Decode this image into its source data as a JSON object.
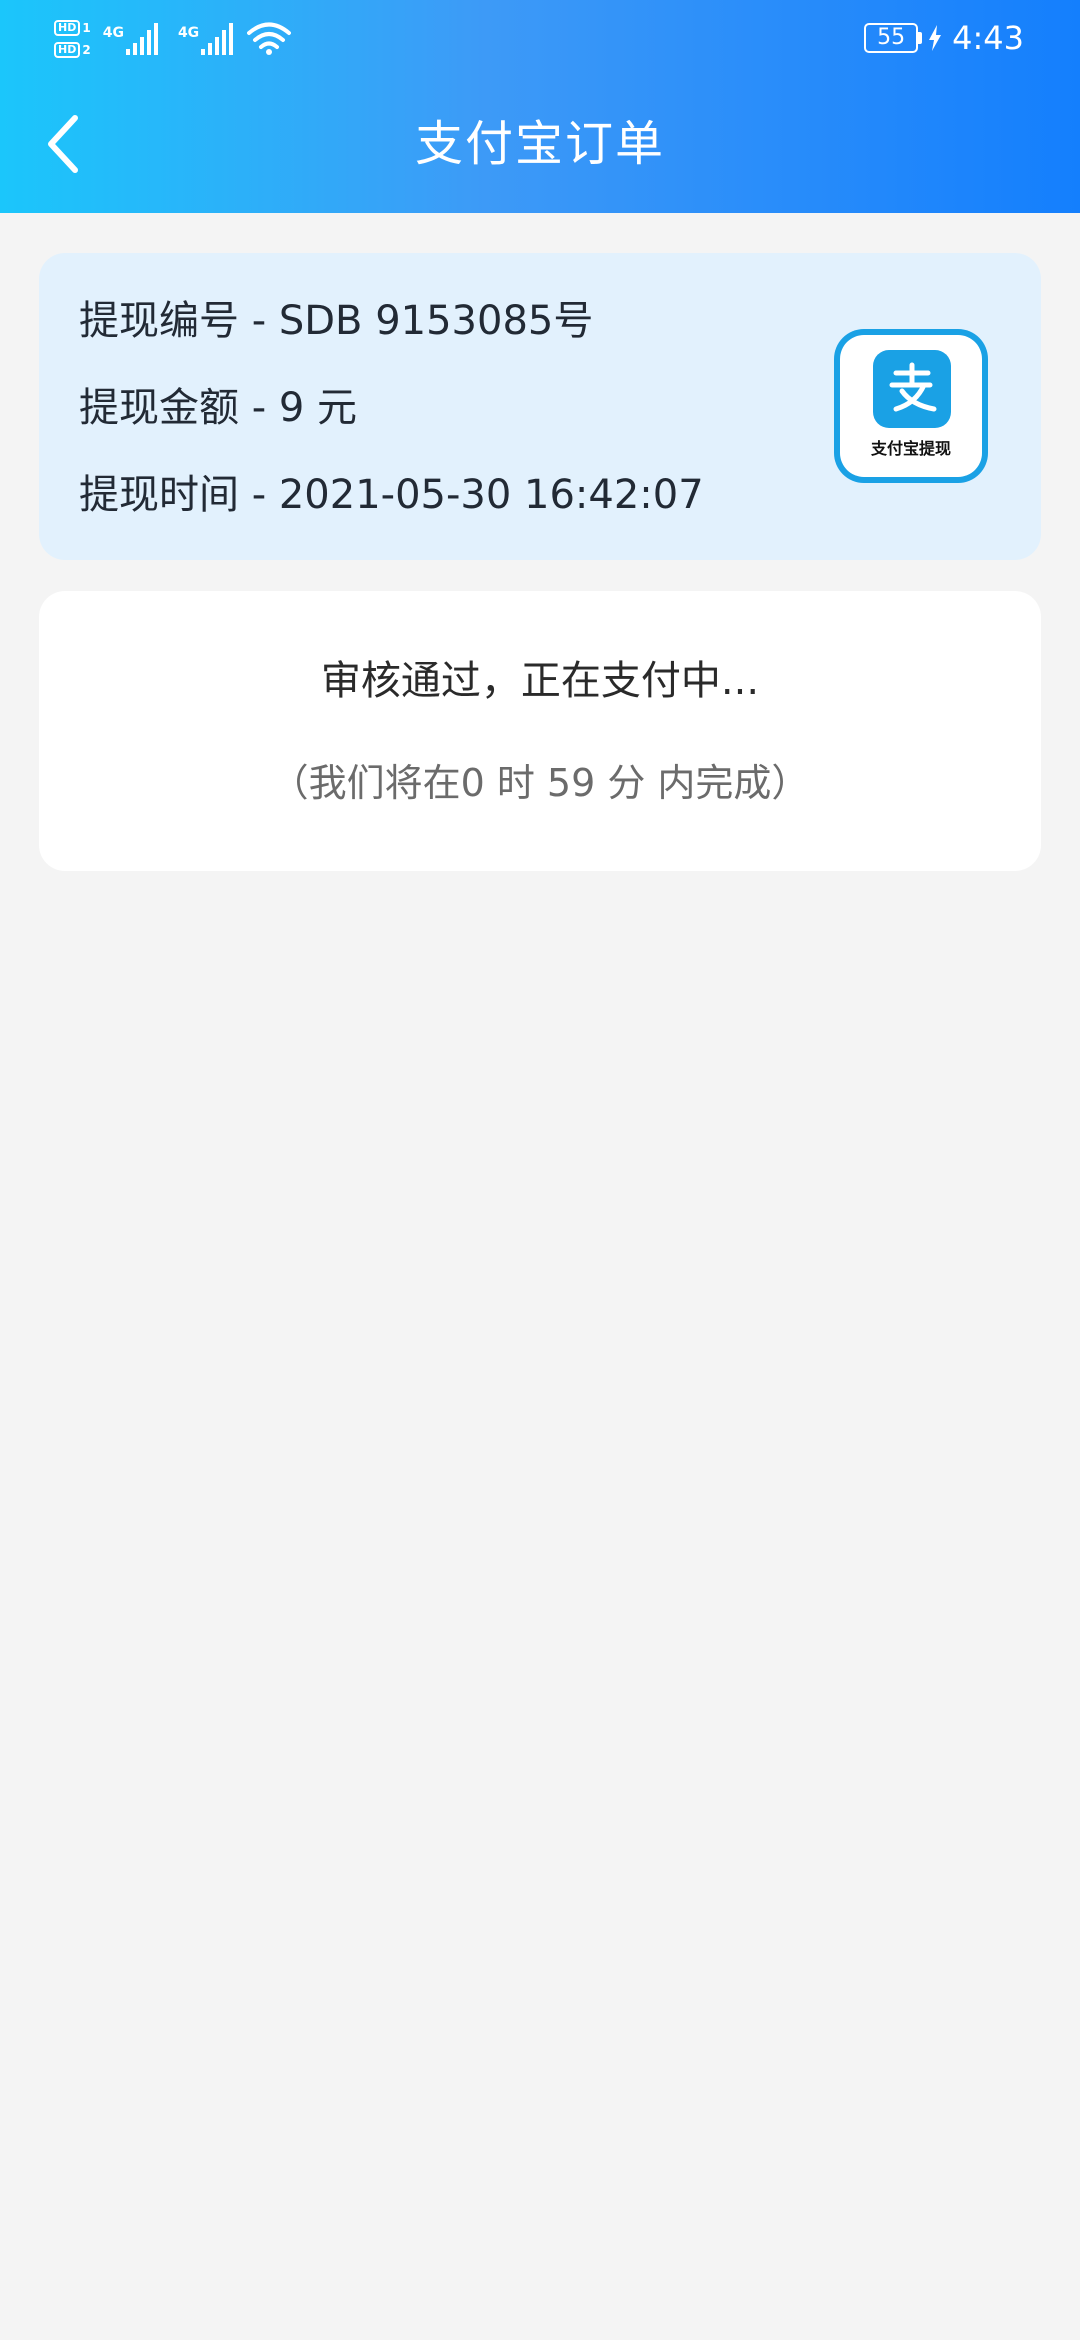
{
  "status_bar": {
    "hd_label": "HD",
    "sim1_index": "1",
    "sim2_index": "2",
    "network1": "4G",
    "network2": "4G",
    "battery": "55",
    "time": "4:43"
  },
  "header": {
    "title": "支付宝订单",
    "back_icon": "chevron-left-icon",
    "gradient": [
      "#1bc6fb",
      "#147ffd"
    ]
  },
  "order_info": {
    "id_line": "提现编号 - SDB 9153085号",
    "amount_line": "提现金额 - 9 元",
    "time_line": "提现时间 - 2021-05-30 16:42:07",
    "logo_caption": "支付宝提现",
    "logo_icon": "alipay-icon"
  },
  "status": {
    "main": "审核通过，正在支付中...",
    "sub": "（我们将在0 时 59 分 内完成）"
  },
  "colors": {
    "page_bg": "#f4f4f4",
    "info_card_bg": "#e2f1fd",
    "alipay_blue": "#1aa1e5"
  }
}
